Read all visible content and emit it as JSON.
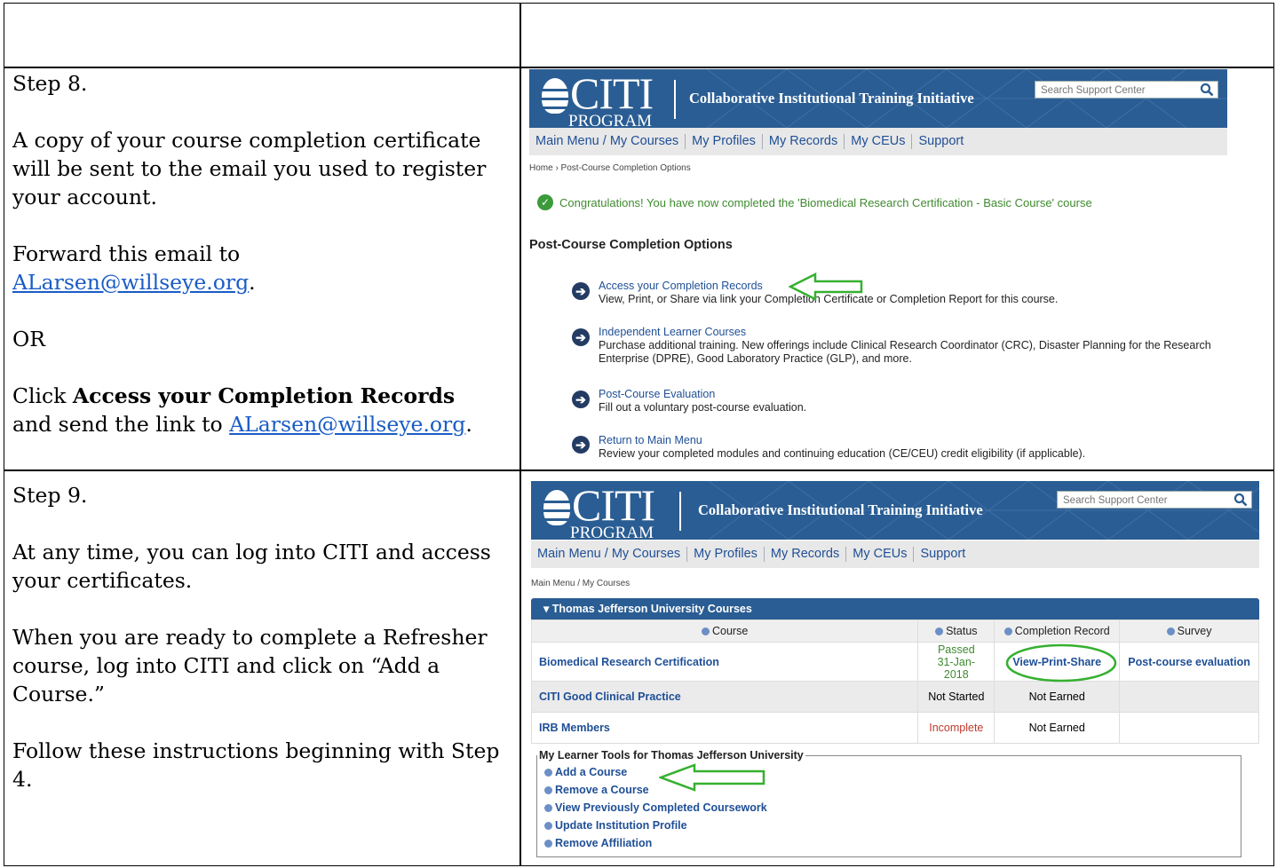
{
  "step8": {
    "title": "Step 8.",
    "para1": "A copy of your course completion certificate will be sent to the email you used to register your account.",
    "para2_prefix": "Forward this email to",
    "email": "ALarsen@willseye.org",
    "period": ".",
    "or": "OR",
    "click": "Click",
    "bold": "Access your Completion Records",
    "send_prefix": "and send the link to",
    "email2": "ALarsen@willseye.org",
    "period2": "."
  },
  "step9": {
    "title": "Step 9.",
    "para1": "At any time, you can log into CITI and access your certificates.",
    "para2": "When you are ready to complete a Refresher course, log into CITI and click on “Add a Course.”",
    "para3": "Follow these instructions beginning with Step 4."
  },
  "citi": {
    "logo": "CITI",
    "logo_sub": "PROGRAM",
    "tagline": "Collaborative Institutional Training Initiative",
    "search_placeholder": "Search Support Center",
    "nav": [
      "Main Menu / My Courses",
      "My Profiles",
      "My Records",
      "My CEUs",
      "Support"
    ]
  },
  "shot1": {
    "breadcrumb": "Home › Post-Course Completion Options",
    "congrats": "Congratulations! You have now completed the 'Biomedical Research Certification - Basic Course' course",
    "heading": "Post-Course Completion Options",
    "options": [
      {
        "title": "Access your Completion Records",
        "desc": "View, Print, or Share via link your Completion Certificate or Completion Report for this course."
      },
      {
        "title": "Independent Learner Courses",
        "desc": "Purchase additional training. New offerings include Clinical Research Coordinator (CRC), Disaster Planning for the Research Enterprise (DPRE), Good Laboratory Practice (GLP), and more."
      },
      {
        "title": "Post-Course Evaluation",
        "desc": "Fill out a voluntary post-course evaluation."
      },
      {
        "title": "Return to Main Menu",
        "desc": "Review your completed modules and continuing education (CE/CEU) credit eligibility (if applicable)."
      }
    ]
  },
  "shot2": {
    "breadcrumb": "Main Menu / My Courses",
    "section": "▾ Thomas Jefferson University Courses",
    "headers": [
      "Course",
      "Status",
      "Completion Record",
      "Survey"
    ],
    "rows": [
      {
        "course": "Biomedical Research Certification",
        "status": "Passed",
        "status2": "31-Jan-2018",
        "record": "View-Print-Share",
        "survey": "Post-course evaluation"
      },
      {
        "course": "CITI Good Clinical Practice",
        "status": "Not Started",
        "record": "Not Earned",
        "survey": ""
      },
      {
        "course": "IRB Members",
        "status": "Incomplete",
        "record": "Not Earned",
        "survey": ""
      }
    ],
    "tools_legend": "My Learner Tools for Thomas Jefferson University",
    "tools": [
      "Add a Course",
      "Remove a Course",
      "View Previously Completed Coursework",
      "Update Institution Profile",
      "Remove Affiliation"
    ]
  },
  "colors": {
    "banner": "#2a5d93",
    "link": "#1f4f96",
    "green": "#3f8a2f",
    "red": "#c0392b"
  }
}
